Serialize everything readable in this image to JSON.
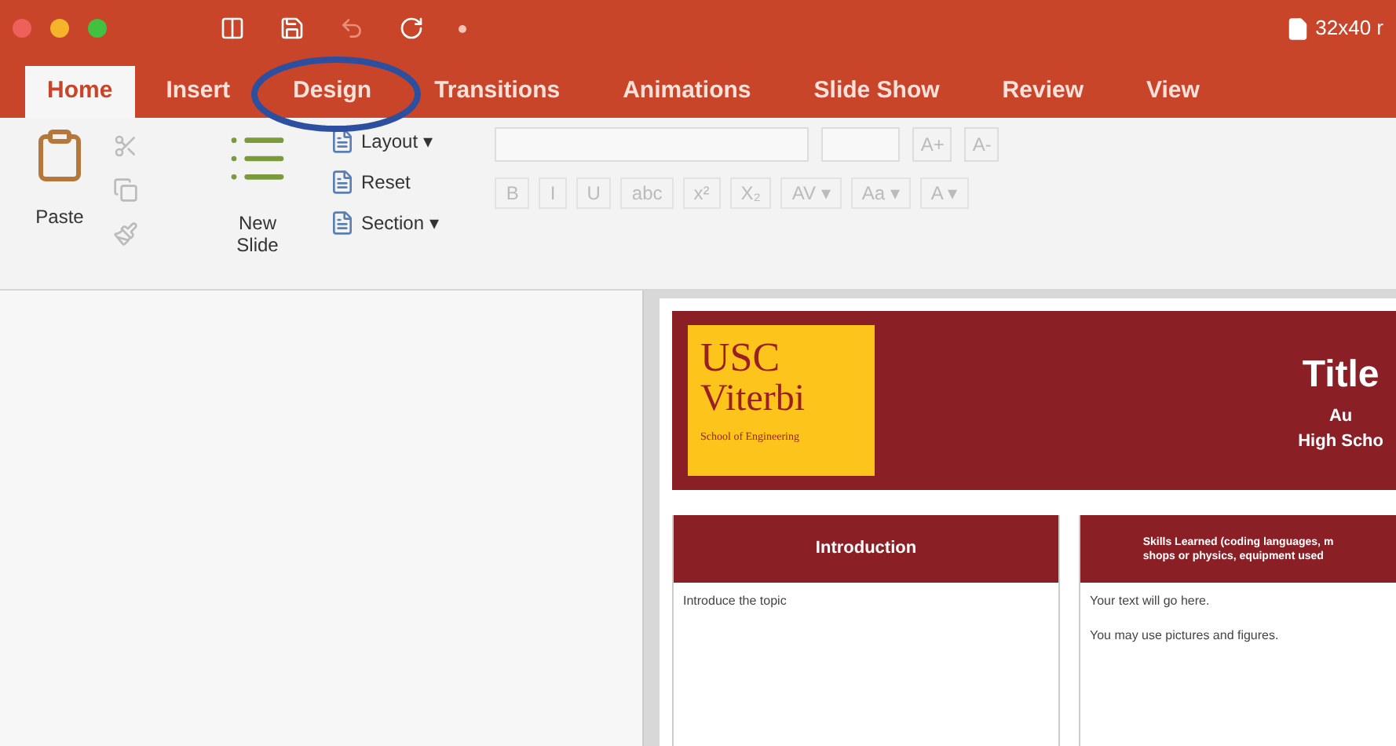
{
  "window": {
    "document_title": "32x40 r"
  },
  "tabs": [
    {
      "label": "Home",
      "selected": true
    },
    {
      "label": "Insert",
      "selected": false
    },
    {
      "label": "Design",
      "selected": false,
      "circled": true
    },
    {
      "label": "Transitions",
      "selected": false
    },
    {
      "label": "Animations",
      "selected": false
    },
    {
      "label": "Slide Show",
      "selected": false
    },
    {
      "label": "Review",
      "selected": false
    },
    {
      "label": "View",
      "selected": false
    }
  ],
  "ribbon": {
    "paste": "Paste",
    "new_slide": "New Slide",
    "slide_commands": [
      "Layout ▾",
      "Reset",
      "Section ▾"
    ],
    "font_size_buttons": [
      "A+",
      "A-"
    ],
    "format_buttons": [
      "B",
      "I",
      "U",
      "abc",
      "x²",
      "X₂",
      "AV ▾",
      "Aa ▾",
      "A ▾"
    ]
  },
  "slide": {
    "logo": {
      "line_1": "USC",
      "line_2": "Viterbi",
      "line_3": "School of Engineering"
    },
    "title": "Title",
    "author": "Au",
    "school": "High Scho",
    "panels": [
      {
        "heading": "Introduction",
        "body": [
          "Introduce the topic"
        ]
      },
      {
        "heading": "Skills Learned (coding languages, m\nshops or physics, equipment used",
        "body": [
          "Your text will go here.",
          "You may use pictures and figures."
        ]
      }
    ]
  }
}
